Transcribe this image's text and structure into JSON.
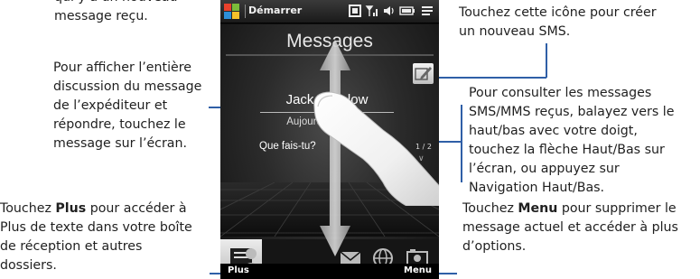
{
  "annotations": {
    "top_partial": "qui y a un nouveau message reçu.",
    "left1": "Pour afficher l’entière discussion du message de l’expéditeur et répondre, touchez le message sur l’écran.",
    "left2_pre": "Touchez ",
    "left2_bold": "Plus",
    "left2_post": " pour accéder à Plus de texte dans votre boîte de réception et autres dossiers.",
    "right1": "Touchez cette icône pour créer un nouveau SMS.",
    "right2": "Pour consulter les messages SMS/MMS reçus, balayez vers le haut/bas avec votre doigt, touchez la flèche Haut/Bas sur l’écran, ou appuyez sur Navigation Haut/Bas.",
    "right3_pre": "Touchez ",
    "right3_bold": "Menu",
    "right3_post": " pour supprimer le message actuel et accéder à plus d’options."
  },
  "phone": {
    "status_start": "Démarrer",
    "screen_title": "Messages",
    "sender": "Jack Winslow",
    "time": "Aujourd’hui 12:28",
    "message": "Que fais-tu?",
    "page_indicator": "1 / 2",
    "softkey_left": "Plus",
    "softkey_right": "Menu",
    "tabs": [
      "contacts",
      "messages",
      "email",
      "internet",
      "photos"
    ],
    "selected_tab": "messages"
  },
  "colors": {
    "leader_line": "#2f5fa7",
    "selected_tab": "#d8d8d8"
  }
}
